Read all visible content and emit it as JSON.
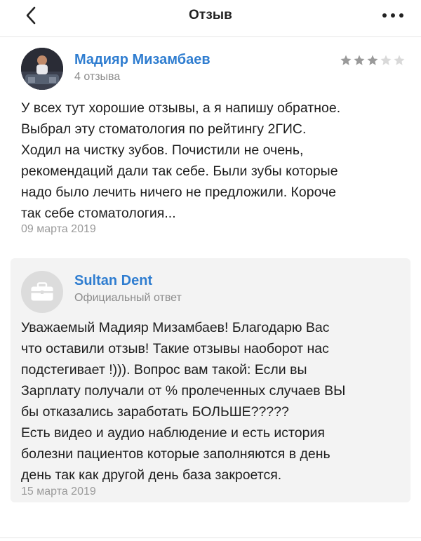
{
  "header": {
    "title": "Отзыв",
    "back_icon": "chevron-left-icon",
    "more_icon": "more-horizontal-icon"
  },
  "review": {
    "author_name": "Мадияр Мизамбаев",
    "author_reviews_count": "4 отзыва",
    "rating": 3,
    "rating_max": 5,
    "text": "У всех тут хорошие отзывы, а я напишу обратное.\nВыбрал эту стоматология по рейтингу 2ГИС.\nХодил на чистку зубов. Почистили не очень,\nрекомендаций дали так себе. Были зубы которые\nнадо было лечить ничего не предложили. Короче\nтак себе стоматология...",
    "date": "09 марта 2019"
  },
  "response": {
    "company_name": "Sultan Dent",
    "label": "Официальный ответ",
    "logo_icon": "briefcase-icon",
    "text": "Уважаемый Мадияр Мизамбаев! Благодарю Вас\nчто оставили отзыв! Такие отзывы наоборот нас\nподстегивает !))). Вопрос вам такой: Если вы\nЗарплату получали от % пролеченных случаев ВЫ\nбы отказались заработать БОЛЬШЕ?????\nЕсть видео и аудио наблюдение и есть история\nболезни пациентов которые заполняются в день\nдень так как другой день база закроется.",
    "date": "15 марта 2019"
  },
  "colors": {
    "link_blue": "#2f7dd0",
    "star_filled": "#9a9a9a",
    "star_empty": "#d9d9d9",
    "card_bg": "#f3f3f3"
  }
}
